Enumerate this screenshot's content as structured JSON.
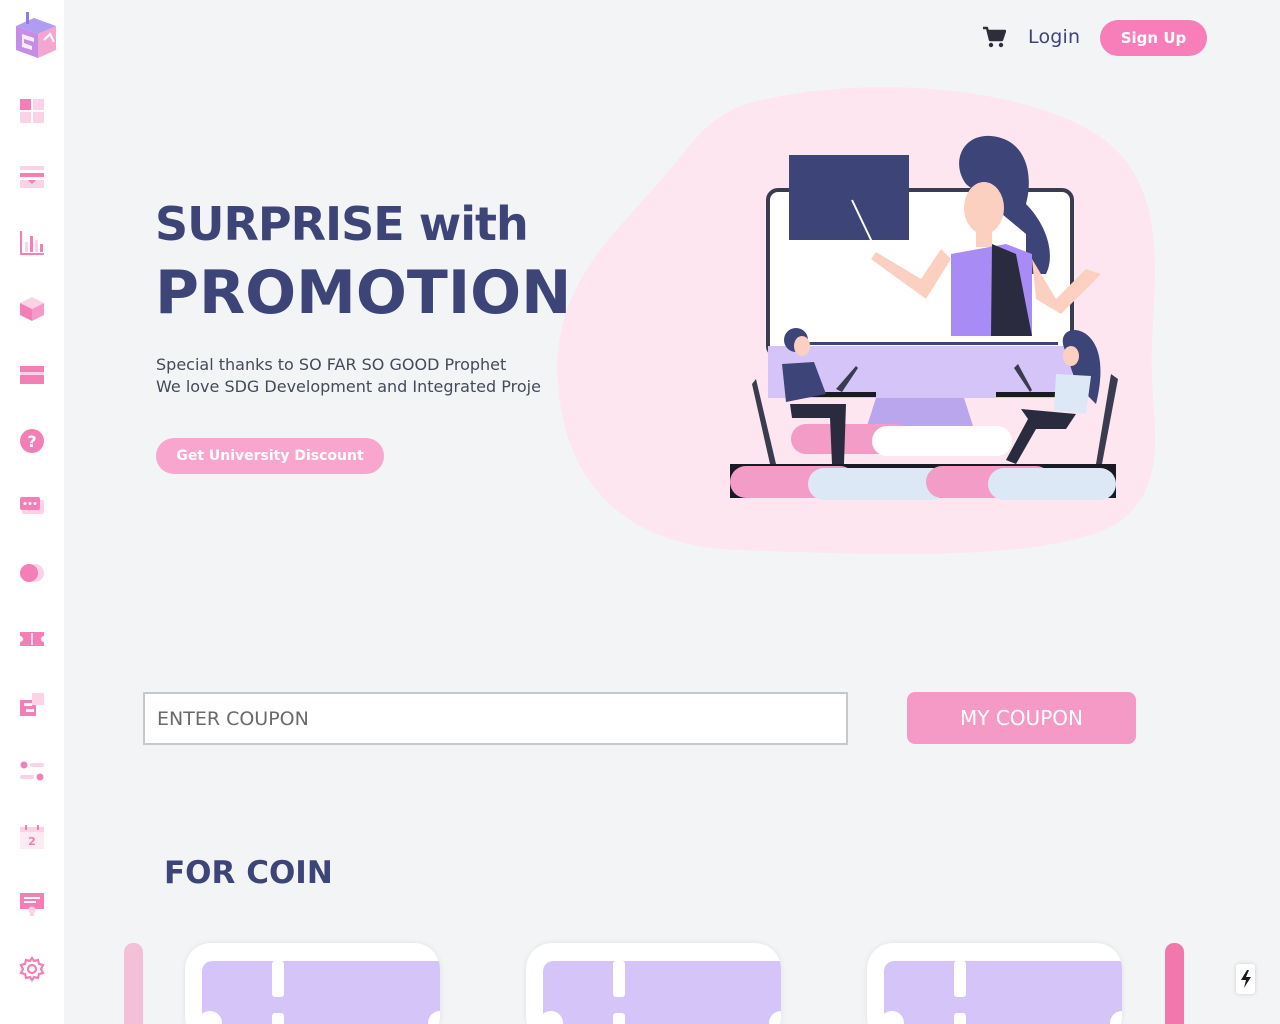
{
  "header": {
    "login_label": "Login",
    "signup_label": "Sign Up"
  },
  "hero": {
    "line1": "SURPRISE with",
    "line2": "PROMOTION",
    "subtitle_line1": "Special thanks to SO FAR SO GOOD Prophet",
    "subtitle_line2": "We love SDG Development and Integrated Proje",
    "discount_button": "Get University Discount"
  },
  "coupon": {
    "placeholder": "ENTER COUPON",
    "button_label": "MY COUPON"
  },
  "coin_section": {
    "title": "FOR COIN"
  },
  "sidebar": {
    "items": [
      "dashboard-icon",
      "inbox-icon",
      "chart-icon",
      "box-icon",
      "card-icon",
      "help-icon",
      "chat-icon",
      "toggle-icon",
      "ticket-icon",
      "puzzle-icon",
      "sliders-icon",
      "calendar-icon",
      "certificate-icon",
      "gear-icon"
    ],
    "calendar_number": "2"
  },
  "colors": {
    "accent_pink": "#f77eb9",
    "navy": "#3d4478",
    "lavender": "#d5c4f8"
  }
}
